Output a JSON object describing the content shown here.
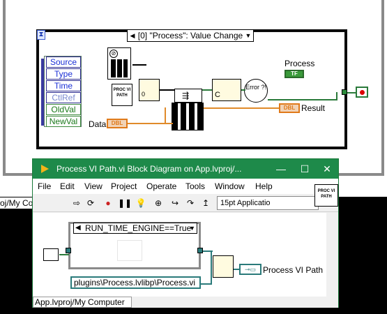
{
  "outer_diagram": {
    "event_case_label": "[0] \"Process\": Value Change",
    "event_data_fields": [
      {
        "label": "Source",
        "color": "blue"
      },
      {
        "label": "Type",
        "color": "blue"
      },
      {
        "label": "Time",
        "color": "blue"
      },
      {
        "label": "CtlRef",
        "color": "blue"
      },
      {
        "label": "OldVal",
        "color": "green"
      },
      {
        "label": "NewVal",
        "color": "green"
      }
    ],
    "proc_vi_path_icon_text": "PROC VI PATH",
    "error_bubble_text": "Error ?!",
    "data_label": "Data",
    "dbl_badge": "DBL",
    "result_label": "Result",
    "process_label": "Process",
    "tf_badge": "TF",
    "zero_const": "0",
    "c_label": "C"
  },
  "window": {
    "title": "Process VI Path.vi Block Diagram on App.lvproj/...",
    "controls": {
      "minimize": "—",
      "maximize": "☐",
      "close": "✕"
    },
    "menu": [
      "File",
      "Edit",
      "View",
      "Project",
      "Operate",
      "Tools",
      "Window",
      "Help"
    ],
    "font_box": "15pt Applicatio",
    "vi_icon_text": "PROC VI PATH",
    "case_selector": "RUN_TIME_ENGINE==True",
    "path_constant": "plugins\\Process.lvlibp\\Process.vi",
    "output_label": "Process VI Path",
    "status_bar": "App.lvproj/My Computer"
  },
  "behind_strip": "oj/My Co",
  "colors": {
    "titlebar": "#1e8a4a",
    "orange_wire": "#e08a2a",
    "green_wire": "#2a7a3a"
  }
}
